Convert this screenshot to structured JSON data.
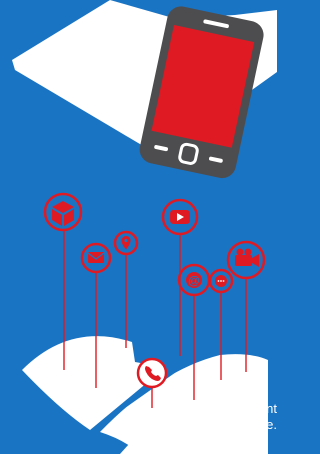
{
  "colors": {
    "background": "#1a74c4",
    "book_pages": "#ffffff",
    "phone_body": "#4d4d4f",
    "phone_screen": "#e01a22",
    "accent_red": "#e01a22"
  },
  "icons": [
    "box-icon",
    "location-pin-icon",
    "mail-icon",
    "youtube-play-icon",
    "at-sign-icon",
    "video-camera-icon",
    "phone-icon",
    "chat-bubble-icon"
  ],
  "caption": {
    "line1": "nt",
    "line2": "e."
  }
}
